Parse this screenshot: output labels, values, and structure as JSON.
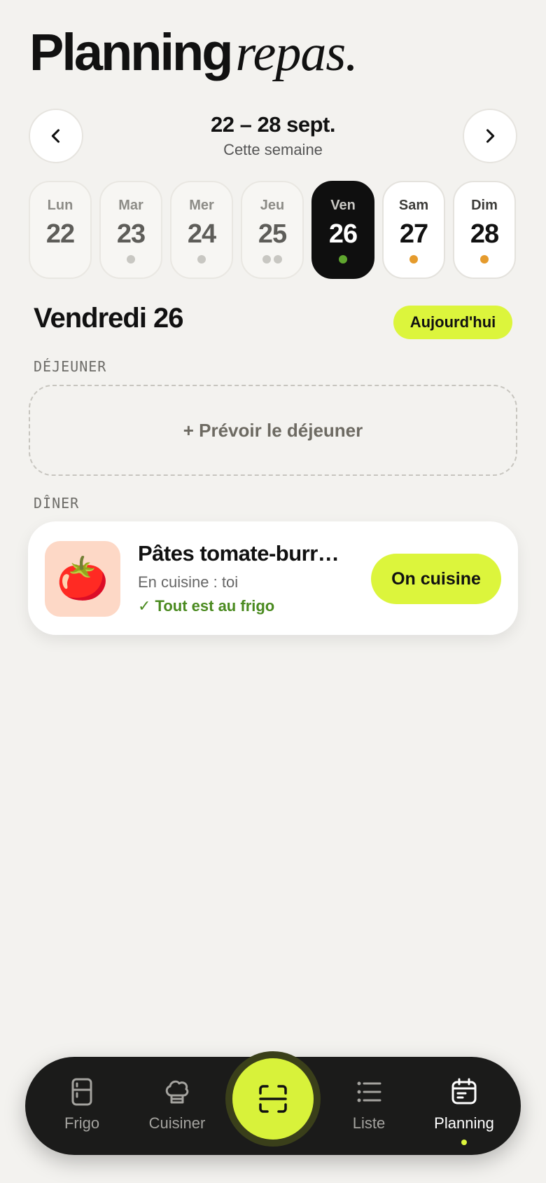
{
  "header": {
    "title_main": "Planning",
    "title_accent": "repas."
  },
  "week": {
    "range": "22 – 28 sept.",
    "subtitle": "Cette semaine"
  },
  "days": [
    {
      "name": "Lun",
      "number": "22",
      "dots": []
    },
    {
      "name": "Mar",
      "number": "23",
      "dots": [
        "gray"
      ]
    },
    {
      "name": "Mer",
      "number": "24",
      "dots": [
        "gray"
      ]
    },
    {
      "name": "Jeu",
      "number": "25",
      "dots": [
        "gray",
        "gray"
      ]
    },
    {
      "name": "Ven",
      "number": "26",
      "dots": [
        "green"
      ],
      "selected": true
    },
    {
      "name": "Sam",
      "number": "27",
      "dots": [
        "orange"
      ]
    },
    {
      "name": "Dim",
      "number": "28",
      "dots": [
        "orange"
      ]
    }
  ],
  "selected_day": {
    "title": "Vendredi 26",
    "badge": "Aujourd'hui"
  },
  "lunch": {
    "label": "DÉJEUNER",
    "placeholder": "+ Prévoir le déjeuner"
  },
  "dinner": {
    "label": "DÎNER",
    "meal": {
      "icon": "tomato-icon",
      "emoji": "🍅",
      "title": "Pâtes tomate-burrata",
      "cook": "En cuisine : toi",
      "status": "✓ Tout est au frigo",
      "action": "On cuisine"
    }
  },
  "tabbar": {
    "tabs": [
      {
        "label": "Frigo",
        "icon": "fridge-icon"
      },
      {
        "label": "Cuisiner",
        "icon": "chef-hat-icon"
      },
      {
        "label": "Liste",
        "icon": "list-icon"
      },
      {
        "label": "Planning",
        "icon": "calendar-icon",
        "active": true
      }
    ],
    "center_icon": "scan-icon"
  },
  "colors": {
    "accent": "#dcf53c",
    "background": "#f3f2ef",
    "dark": "#1b1b1a",
    "success": "#4a8a1f",
    "orange_dot": "#e59b2d"
  }
}
